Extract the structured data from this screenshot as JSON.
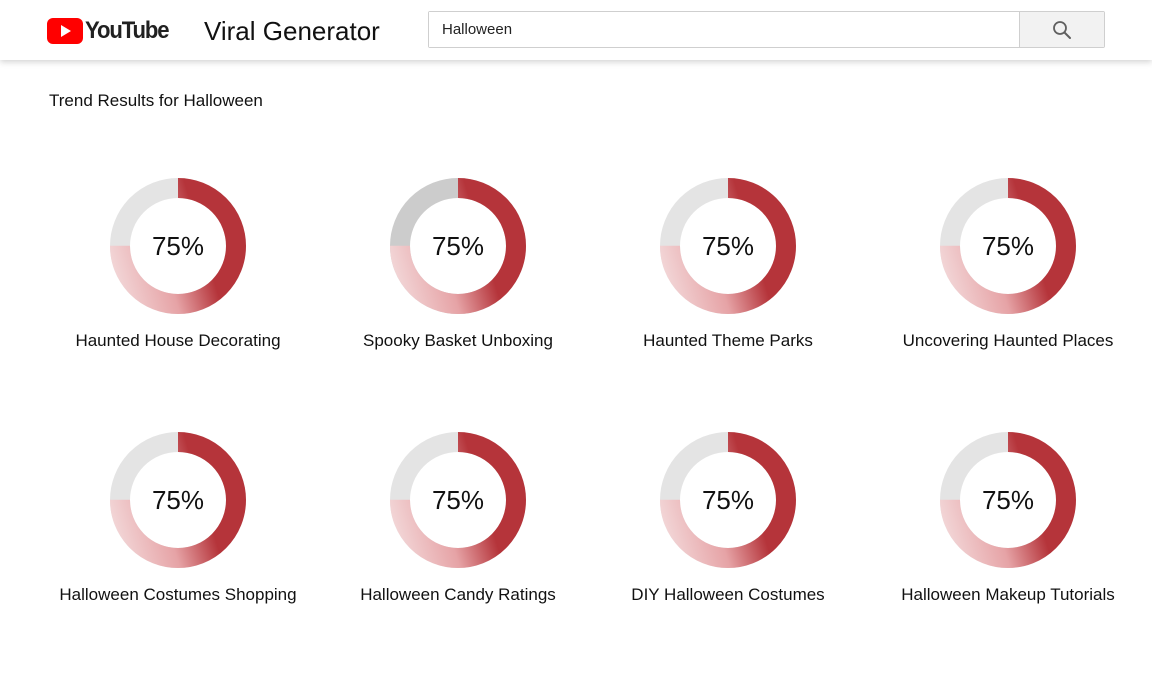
{
  "header": {
    "logo_text": "YouTube",
    "app_title": "Viral Generator",
    "search": {
      "value": "Halloween",
      "placeholder": "Halloween"
    },
    "search_icon": "search-icon",
    "brand_red": "#ff0000"
  },
  "main": {
    "results_title": "Trend Results for Halloween",
    "accent_color": "#b5343a",
    "track_color": "#e4e4e4",
    "trends": [
      {
        "label": "Haunted House Decorating",
        "percent": 75,
        "percent_label": "75%"
      },
      {
        "label": "Spooky Basket Unboxing",
        "percent": 75,
        "percent_label": "75%"
      },
      {
        "label": "Haunted Theme Parks",
        "percent": 75,
        "percent_label": "75%"
      },
      {
        "label": "Uncovering Haunted Places",
        "percent": 75,
        "percent_label": "75%"
      },
      {
        "label": "Halloween Costumes Shopping",
        "percent": 75,
        "percent_label": "75%"
      },
      {
        "label": "Halloween Candy Ratings",
        "percent": 75,
        "percent_label": "75%"
      },
      {
        "label": "DIY Halloween Costumes",
        "percent": 75,
        "percent_label": "75%"
      },
      {
        "label": "Halloween Makeup Tutorials",
        "percent": 75,
        "percent_label": "75%"
      }
    ]
  }
}
